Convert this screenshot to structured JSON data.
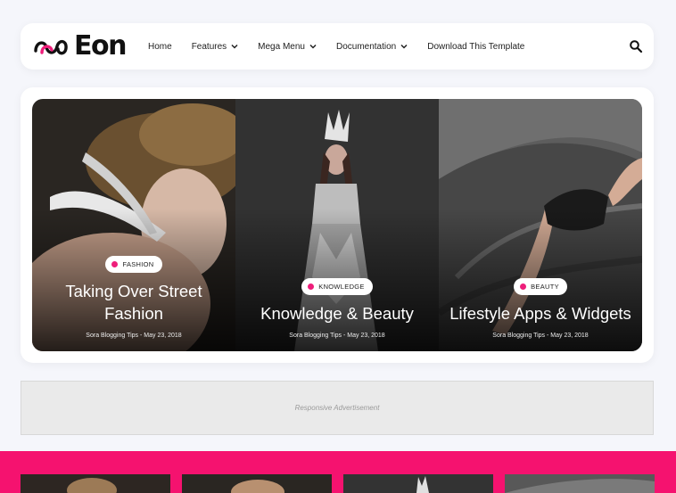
{
  "brand": {
    "logo_text": "Eon",
    "accent": "#ee1e7a"
  },
  "nav": {
    "items": [
      {
        "label": "Home",
        "has_dropdown": false
      },
      {
        "label": "Features",
        "has_dropdown": true
      },
      {
        "label": "Mega Menu",
        "has_dropdown": true
      },
      {
        "label": "Documentation",
        "has_dropdown": true
      },
      {
        "label": "Download This Template",
        "has_dropdown": false
      }
    ],
    "search_icon": "search-icon"
  },
  "slides": [
    {
      "category": "FASHION",
      "title": "Taking Over Street Fashion",
      "meta": "Sora Blogging Tips - May 23, 2018"
    },
    {
      "category": "KNOWLEDGE",
      "title": "Knowledge & Beauty",
      "meta": "Sora Blogging Tips - May 23, 2018"
    },
    {
      "category": "BEAUTY",
      "title": "Lifestyle Apps & Widgets",
      "meta": "Sora Blogging Tips - May 23, 2018"
    }
  ],
  "ad": {
    "label": "Responsive Advertisement"
  },
  "section": {
    "background": "#f5126f"
  }
}
